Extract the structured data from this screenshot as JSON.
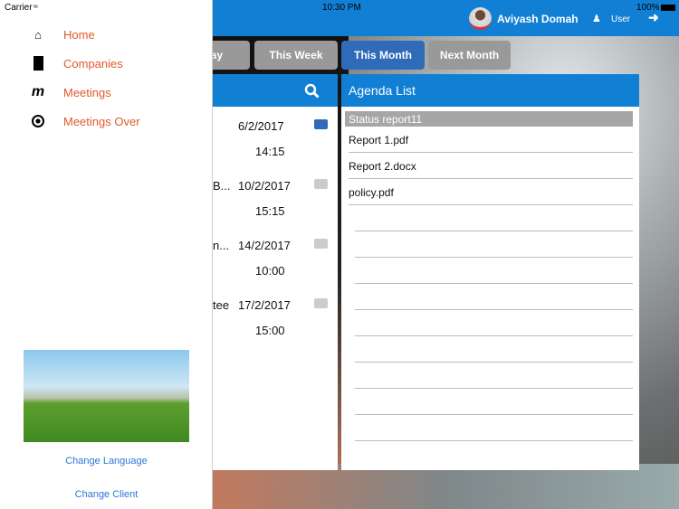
{
  "status": {
    "carrier": "Carrier",
    "time": "10:30 PM",
    "battery": "100%"
  },
  "header": {
    "user_name": "Aviyash Domah",
    "role": "User"
  },
  "tabs": [
    {
      "label": "Today",
      "visible": "ay"
    },
    {
      "label": "This Week"
    },
    {
      "label": "This Month",
      "active": true
    },
    {
      "label": "Next Month"
    }
  ],
  "meetings": [
    {
      "title": "",
      "date": "6/2/2017",
      "time": "14:15",
      "active": true
    },
    {
      "title": "B...",
      "date": "10/2/2017",
      "time": "15:15"
    },
    {
      "title": "n...",
      "date": "14/2/2017",
      "time": "10:00"
    },
    {
      "title": "tee",
      "date": "17/2/2017",
      "time": "15:00"
    }
  ],
  "agenda": {
    "title": "Agenda List",
    "selected": "Status report11",
    "items": [
      "Report 1.pdf",
      "Report 2.docx",
      "policy.pdf"
    ]
  },
  "drawer": {
    "items": [
      {
        "label": "Home",
        "icon": "home-icon"
      },
      {
        "label": "Companies",
        "icon": "building-icon"
      },
      {
        "label": "Meetings",
        "icon": "meetings-logo-icon"
      },
      {
        "label": "Meetings Over",
        "icon": "stop-circle-icon"
      }
    ],
    "change_language": "Change Language",
    "change_client": "Change Client"
  },
  "colors": {
    "accent": "#1180d4",
    "nav_text": "#e05a2a",
    "active_tab": "#2f6bb8",
    "link": "#2d77d4"
  }
}
